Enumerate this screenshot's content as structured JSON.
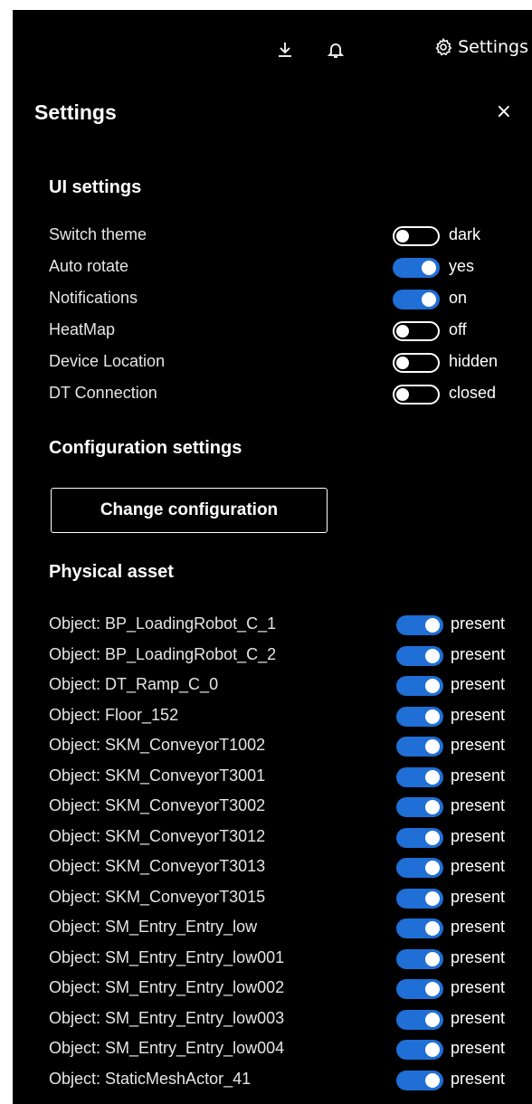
{
  "topbar": {
    "download_icon": "download-icon",
    "bell_icon": "bell-icon",
    "settings_icon": "gear-icon",
    "settings_label": "Settings"
  },
  "panel": {
    "title": "Settings",
    "close_icon": "close-icon",
    "close_glyph": "×"
  },
  "ui_settings": {
    "heading": "UI settings",
    "items": [
      {
        "label": "Switch theme",
        "on": false,
        "state": "dark"
      },
      {
        "label": "Auto rotate",
        "on": true,
        "state": "yes"
      },
      {
        "label": "Notifications",
        "on": true,
        "state": "on"
      },
      {
        "label": "HeatMap",
        "on": false,
        "state": "off"
      },
      {
        "label": "Device Location",
        "on": false,
        "state": "hidden"
      },
      {
        "label": "DT Connection",
        "on": false,
        "state": "closed"
      }
    ]
  },
  "configuration": {
    "heading": "Configuration settings",
    "button_label": "Change configuration"
  },
  "physical_asset": {
    "heading": "Physical asset",
    "items": [
      {
        "label": "Object: BP_LoadingRobot_C_1",
        "on": true,
        "state": "present"
      },
      {
        "label": "Object: BP_LoadingRobot_C_2",
        "on": true,
        "state": "present"
      },
      {
        "label": "Object: DT_Ramp_C_0",
        "on": true,
        "state": "present"
      },
      {
        "label": "Object: Floor_152",
        "on": true,
        "state": "present"
      },
      {
        "label": "Object: SKM_ConveyorT1002",
        "on": true,
        "state": "present"
      },
      {
        "label": "Object: SKM_ConveyorT3001",
        "on": true,
        "state": "present"
      },
      {
        "label": "Object: SKM_ConveyorT3002",
        "on": true,
        "state": "present"
      },
      {
        "label": "Object: SKM_ConveyorT3012",
        "on": true,
        "state": "present"
      },
      {
        "label": "Object: SKM_ConveyorT3013",
        "on": true,
        "state": "present"
      },
      {
        "label": "Object: SKM_ConveyorT3015",
        "on": true,
        "state": "present"
      },
      {
        "label": "Object: SM_Entry_Entry_low",
        "on": true,
        "state": "present"
      },
      {
        "label": "Object: SM_Entry_Entry_low001",
        "on": true,
        "state": "present"
      },
      {
        "label": "Object: SM_Entry_Entry_low002",
        "on": true,
        "state": "present"
      },
      {
        "label": "Object: SM_Entry_Entry_low003",
        "on": true,
        "state": "present"
      },
      {
        "label": "Object: SM_Entry_Entry_low004",
        "on": true,
        "state": "present"
      },
      {
        "label": "Object: StaticMeshActor_41",
        "on": true,
        "state": "present"
      }
    ]
  },
  "colors": {
    "background": "#000000",
    "toggle_on": "#1f6fd6",
    "text": "#ffffff"
  }
}
